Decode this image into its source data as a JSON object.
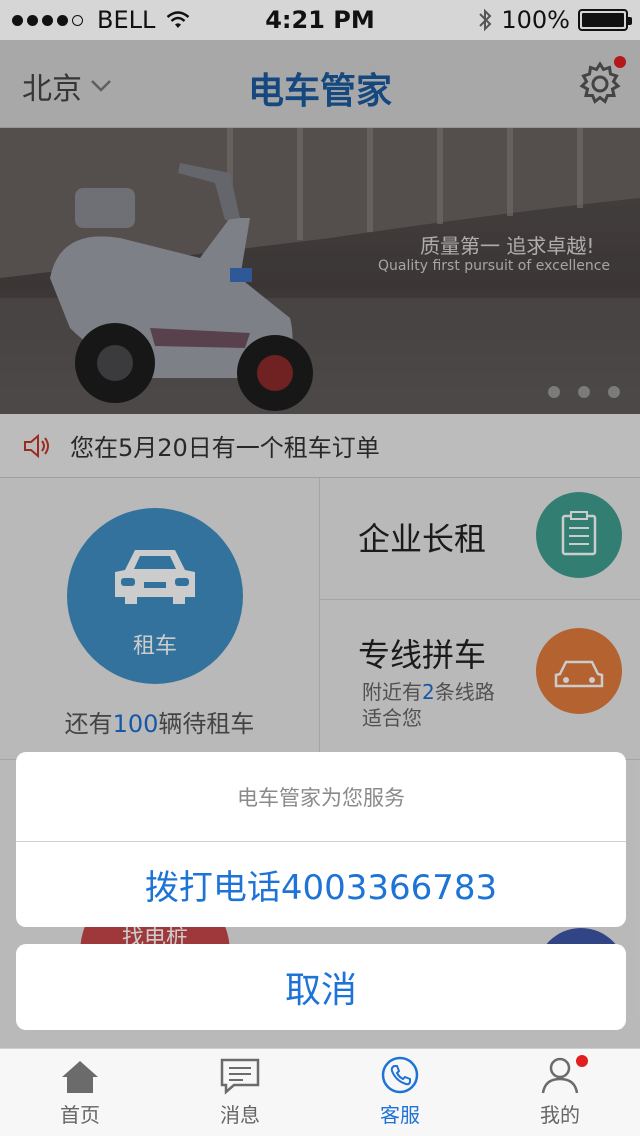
{
  "status_bar": {
    "carrier": "BELL",
    "time": "4:21 PM",
    "battery": "100%",
    "battery_level": 1.0
  },
  "nav": {
    "city": "北京",
    "title": "电车管家"
  },
  "banner": {
    "slogan": "质量第一 追求卓越!",
    "subtitle": "Quality first pursuit of excellence",
    "page_count": 3
  },
  "notice": {
    "text": "您在5月20日有一个租车订单"
  },
  "grid": {
    "rent": {
      "label": "租车",
      "stock_prefix": "还有",
      "stock_count": "100",
      "stock_suffix": "辆待租车"
    },
    "enterprise": {
      "title": "企业长租"
    },
    "carpool": {
      "title": "专线拼车",
      "line_prefix": "附近有",
      "line_count": "2",
      "line_suffix": "条线路",
      "line_note": "适合您"
    },
    "find_pile": {
      "label": "找电桩"
    }
  },
  "action_sheet": {
    "header": "电车管家为您服务",
    "call_label": "拨打电话4003366783",
    "cancel_label": "取消"
  },
  "tabs": [
    {
      "label": "首页",
      "icon": "home-icon"
    },
    {
      "label": "消息",
      "icon": "message-icon"
    },
    {
      "label": "客服",
      "icon": "phone-icon"
    },
    {
      "label": "我的",
      "icon": "user-icon"
    }
  ],
  "colors": {
    "brand": "#1a5a9e",
    "link": "#1e73d6",
    "rent_circle": "#3f8fc4",
    "enterprise_circle": "#3f9e8f",
    "carpool_circle": "#e07b3c",
    "badge": "#e0201f"
  }
}
